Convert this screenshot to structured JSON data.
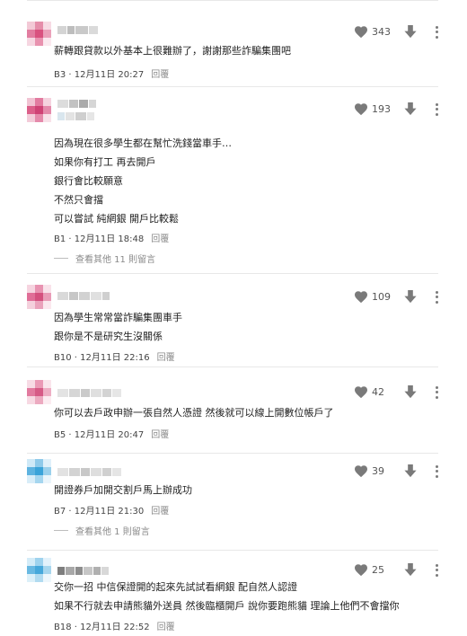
{
  "icons": {
    "like": "heart-icon",
    "dislike": "arrow-down-icon",
    "menu": "more-vertical-icon"
  },
  "colors": {
    "icon": "#7a7a7a",
    "reply": "#8a8a8a"
  },
  "comments": [
    {
      "likes": "343",
      "lines": [
        "薪轉跟貸款以外基本上很難辦了，謝謝那些詐騙集團吧"
      ],
      "floor_time": "B3 · 12月11日 20:27",
      "reply": "回覆"
    },
    {
      "likes": "193",
      "lines": [
        "因為現在很多學生都在幫忙洗錢當車手…",
        "如果你有打工 再去開戶",
        "銀行會比較願意",
        "不然只會擋",
        "可以嘗試 純網銀 開戶比較鬆"
      ],
      "floor_time": "B1 · 12月11日 18:48",
      "reply": "回覆",
      "more_replies": "查看其他 11 則留言"
    },
    {
      "likes": "109",
      "lines": [
        "因為學生常常當詐騙集團車手",
        "跟你是不是研究生沒關係"
      ],
      "floor_time": "B10 · 12月11日 22:16",
      "reply": "回覆"
    },
    {
      "likes": "42",
      "lines": [
        "你可以去戶政申辦一張自然人憑證 然後就可以線上開數位帳戶了"
      ],
      "floor_time": "B5 · 12月11日 20:47",
      "reply": "回覆"
    },
    {
      "likes": "39",
      "lines": [
        "開證券戶加開交割戶馬上辦成功"
      ],
      "floor_time": "B7 · 12月11日 21:30",
      "reply": "回覆",
      "more_replies": "查看其他 1 則留言"
    },
    {
      "likes": "25",
      "lines": [
        "交你一招 中信保證開的起來先試試看網銀 配自然人認證",
        "如果不行就去申請熊貓外送員 然後臨櫃開戶 說你要跑熊貓 理論上他們不會擋你"
      ],
      "floor_time": "B18 · 12月11日 22:52",
      "reply": "回覆"
    }
  ]
}
